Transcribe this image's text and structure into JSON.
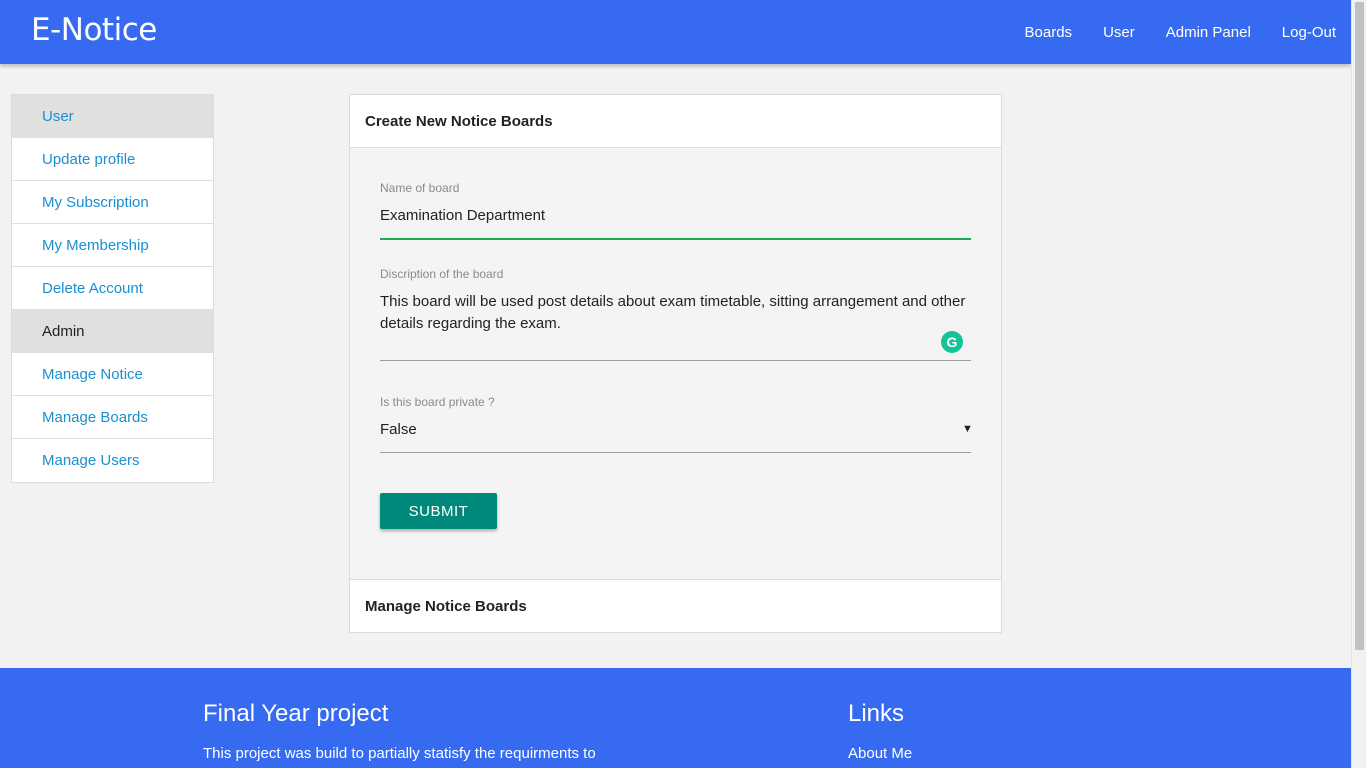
{
  "app": {
    "brand": "E-Notice"
  },
  "nav": {
    "boards": "Boards",
    "user": "User",
    "admin_panel": "Admin Panel",
    "logout": "Log-Out"
  },
  "sidebar": {
    "items": [
      {
        "label": "User",
        "header": true
      },
      {
        "label": "Update profile"
      },
      {
        "label": "My Subscription"
      },
      {
        "label": "My Membership"
      },
      {
        "label": "Delete Account"
      },
      {
        "label": "Admin",
        "header": true
      },
      {
        "label": "Manage Notice"
      },
      {
        "label": "Manage Boards"
      },
      {
        "label": "Manage Users"
      }
    ]
  },
  "form": {
    "title": "Create New Notice Boards",
    "name_label": "Name of board",
    "name_value": "Examination Department",
    "desc_label": "Discription of the board",
    "desc_value": "This board will be used post details about exam timetable, sitting arrangement and other details regarding the exam.",
    "private_label": "Is this board private ?",
    "private_value": "False",
    "submit": "SUBMIT",
    "footer_title": "Manage Notice Boards"
  },
  "icons": {
    "grammarly": "G",
    "dropdown": "▼"
  },
  "colors": {
    "primary": "#356af1",
    "submit": "#00897b",
    "link": "#1a8fd1",
    "active_line": "#1eaa4e"
  },
  "footer": {
    "left_title": "Final Year project",
    "left_text": "This project was build to partially statisfy the requirments to",
    "right_title": "Links",
    "right_link": "About Me"
  }
}
